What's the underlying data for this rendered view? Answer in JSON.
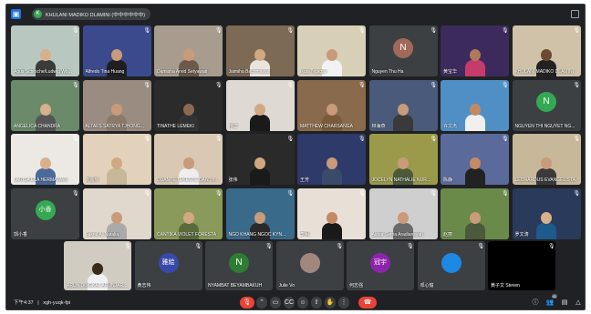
{
  "topbar": {
    "app_icon": "meet-icon",
    "presenter_initial": "K",
    "presenter_label": "KHULANI MADIKO DLAMINI (中中中中中中)"
  },
  "tiles": [
    {
      "name": "Agus Scorsche/Ludwig Wo...",
      "bg": "#b8c7c0",
      "type": "video",
      "skin": "#d9b08c",
      "shirt": "#3b3b3b"
    },
    {
      "name": "Alfredo Tina Huang",
      "bg": "#3b4a8c",
      "type": "video",
      "skin": "#c99b7a",
      "shirt": "#1f1f1f"
    },
    {
      "name": "Damisha Arvid Setyawati",
      "bg": "#a89c8e",
      "type": "video",
      "skin": "#c99b7a",
      "shirt": "#6b5a4a"
    },
    {
      "name": "Jaimiha Bachmawati",
      "bg": "#7d6a55",
      "type": "video",
      "skin": "#d2a882",
      "shirt": "#e9e4dc"
    },
    {
      "name": "Ikuta Ngagas",
      "bg": "#d8cfb8",
      "type": "video",
      "skin": "#c89a78",
      "shirt": "#f2f2f2"
    },
    {
      "name": "Nguyen Thu Ha",
      "bg": "#3c4043",
      "type": "avatar",
      "initial": "N",
      "color": "#a0695a"
    },
    {
      "name": "黄宝华",
      "bg": "#3c2a5c",
      "type": "video",
      "skin": "#b07a5a",
      "shirt": "#c63b6a"
    },
    {
      "name": "KHULANI MADIKO DLAMINI",
      "bg": "#cfc2a8",
      "type": "video",
      "skin": "#6b4a33",
      "shirt": "#222"
    },
    {
      "name": "ANGELICA CHANDRA",
      "bg": "#6a8a6a",
      "type": "video",
      "skin": "#d9b08c",
      "shirt": "#555"
    },
    {
      "name": "ALTAFS SATRYA TJHONG...",
      "bg": "#9a8c80",
      "type": "video",
      "skin": "#c99b7a",
      "shirt": "#8a7a6a"
    },
    {
      "name": "TINATHE LEMEKI",
      "bg": "#2b2b2b",
      "type": "video",
      "skin": "#8b6a50",
      "shirt": "#333"
    },
    {
      "name": "林华",
      "bg": "#ded9d2",
      "type": "video",
      "skin": "#d2a882",
      "shirt": "#1a1a1a"
    },
    {
      "name": "MATTHEW CHARSANGA",
      "bg": "#8a6a4c",
      "type": "video",
      "skin": "#c99b7a",
      "shirt": "#7a5a3a"
    },
    {
      "name": "林海燕",
      "bg": "#4a5a7a",
      "type": "video",
      "skin": "#c99b7a",
      "shirt": "#3a3a3a"
    },
    {
      "name": "许文杰",
      "bg": "#4f8fc6",
      "type": "video",
      "skin": "#c48a64",
      "shirt": "#f0f0f0"
    },
    {
      "name": "NGUYEN THI NGUYET NG...",
      "bg": "#3c4043",
      "type": "avatar",
      "initial": "N",
      "color": "#34a853"
    },
    {
      "name": "LARISA ELA HERMAWAN",
      "bg": "#ece9e4",
      "type": "video",
      "skin": "#d9b08c",
      "shirt": "#4a6a9a"
    },
    {
      "name": "刘嘉欣",
      "bg": "#e2d2bc",
      "type": "video",
      "skin": "#d2a882",
      "shirt": "#c8b89a"
    },
    {
      "name": "DUANTE TEKESTE DANTHAN",
      "bg": "#d8c8b4",
      "type": "video",
      "skin": "#c99b7a",
      "shirt": "#eee"
    },
    {
      "name": "张伟",
      "bg": "#2a2a2a",
      "type": "video",
      "skin": "#d2a882",
      "shirt": "#1a1a1a"
    },
    {
      "name": "王芳",
      "bg": "#2e3a6a",
      "type": "video",
      "skin": "#c99b7a",
      "shirt": "#3a4a6a"
    },
    {
      "name": "JOCELYN NATHALIE NUR...",
      "bg": "#9a9a4a",
      "type": "video",
      "skin": "#c99b7a",
      "shirt": "#4a5a3a"
    },
    {
      "name": "陈静",
      "bg": "#5a6a9a",
      "type": "video",
      "skin": "#c48a64",
      "shirt": "#222"
    },
    {
      "name": "LEONARDUS EVANGELISTA",
      "bg": "#c8b89a",
      "type": "video",
      "skin": "#c99b7a",
      "shirt": "#3a3a3a"
    },
    {
      "name": "郭小香",
      "bg": "#3c4043",
      "type": "avatar",
      "initial": "小香",
      "color": "#34a853"
    },
    {
      "name": "Fakrul A. Natalia",
      "bg": "#e0d8cc",
      "type": "video",
      "skin": "#c99b7a",
      "shirt": "#aaa"
    },
    {
      "name": "CANTIKA VIOLET FORESTA",
      "bg": "#8a9a5a",
      "type": "video",
      "skin": "#d2a882",
      "shirt": "#5a6a3a"
    },
    {
      "name": "NGO KHANG NGOC KYN...",
      "bg": "#3a6a8a",
      "type": "video",
      "skin": "#c99b7a",
      "shirt": "#2a2a2a"
    },
    {
      "name": "李明",
      "bg": "#e8e0d6",
      "type": "video",
      "skin": "#c48a64",
      "shirt": "#1a1a1a"
    },
    {
      "name": "Akbar Satria Aradiansyah",
      "bg": "#cfcfcf",
      "type": "video",
      "skin": "#c99b7a",
      "shirt": "#6a6a6a"
    },
    {
      "name": "赵丽",
      "bg": "#6a8a4a",
      "type": "video",
      "skin": "#c99b7a",
      "shirt": "#4a5a3a"
    },
    {
      "name": "罗文涛",
      "bg": "#2a3a5a",
      "type": "video",
      "skin": "#d9b08c",
      "shirt": "#1e5a8a"
    }
  ],
  "bottom_tiles": [
    {
      "name": "ARUN DINGKAL ARUNJAR...",
      "type": "video",
      "bg": "#d0ccc2",
      "skin": "#3a2a1a",
      "shirt": "#f0f0f0"
    },
    {
      "name": "黄志伟",
      "type": "avatar",
      "initial": "雅絵",
      "color": "#3949ab"
    },
    {
      "name": "NYAMBAT BEYAMBAKUH",
      "type": "avatar",
      "initial": "N",
      "color": "#2e7d32"
    },
    {
      "name": "Julie Vo",
      "type": "avatar",
      "initial": "",
      "color": "#a1887f"
    },
    {
      "name": "何志强",
      "type": "avatar",
      "initial": "冠宇",
      "color": "#8e24aa"
    },
    {
      "name": "邓心愉",
      "type": "avatar",
      "initial": "",
      "color": "#1e88e5"
    },
    {
      "name": "黄子文 Steven",
      "type": "video",
      "bg": "#000000",
      "skin": "#000",
      "shirt": "#000"
    }
  ],
  "controls": {
    "time": "下午4:37",
    "divider": "|",
    "meeting_code": "xgh-yuqk-fpi",
    "participants_count": "41"
  },
  "colors": {
    "end_call": "#ea4335",
    "accent": "#1a73e8"
  }
}
